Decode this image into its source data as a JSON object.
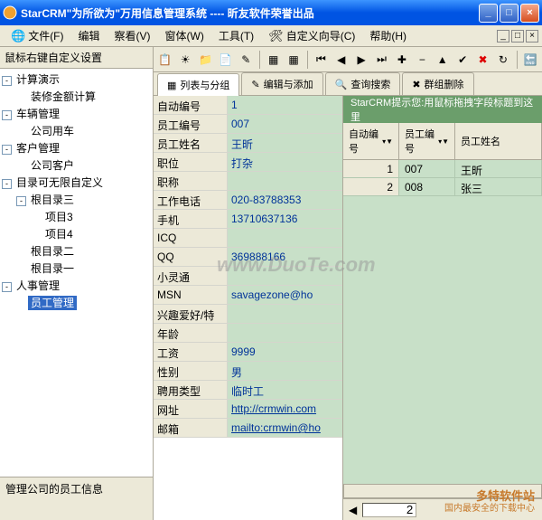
{
  "window": {
    "title": "StarCRM\"为所欲为\"万用信息管理系统 ---- 昕友软件荣誉出品"
  },
  "menu": {
    "file": "文件(F)",
    "edit": "编辑",
    "view": "察看(V)",
    "window": "窗体(W)",
    "tools": "工具(T)",
    "wizard": "自定义向导(C)",
    "help": "帮助(H)"
  },
  "sidebar": {
    "title": "鼠标右键自定义设置",
    "footer": "管理公司的员工信息",
    "nodes": [
      {
        "label": "计算演示",
        "depth": 0,
        "exp": "-"
      },
      {
        "label": "装修金额计算",
        "depth": 1,
        "leaf": true
      },
      {
        "label": "车辆管理",
        "depth": 0,
        "exp": "-"
      },
      {
        "label": "公司用车",
        "depth": 1,
        "leaf": true
      },
      {
        "label": "客户管理",
        "depth": 0,
        "exp": "-"
      },
      {
        "label": "公司客户",
        "depth": 1,
        "leaf": true
      },
      {
        "label": "目录可无限自定义",
        "depth": 0,
        "exp": "-"
      },
      {
        "label": "根目录三",
        "depth": 1,
        "exp": "-"
      },
      {
        "label": "项目3",
        "depth": 2,
        "leaf": true
      },
      {
        "label": "项目4",
        "depth": 2,
        "leaf": true
      },
      {
        "label": "根目录二",
        "depth": 1,
        "leaf": true
      },
      {
        "label": "根目录一",
        "depth": 1,
        "leaf": true
      },
      {
        "label": "人事管理",
        "depth": 0,
        "exp": "-"
      },
      {
        "label": "员工管理",
        "depth": 1,
        "leaf": true,
        "sel": true
      }
    ]
  },
  "tabs": {
    "list": "列表与分组",
    "edit": "编辑与添加",
    "search": "查询搜索",
    "group": "群组删除"
  },
  "form": [
    {
      "k": "自动编号",
      "v": "1"
    },
    {
      "k": "员工编号",
      "v": "007"
    },
    {
      "k": "员工姓名",
      "v": "王昕"
    },
    {
      "k": "职位",
      "v": "打杂"
    },
    {
      "k": "职称",
      "v": ""
    },
    {
      "k": "工作电话",
      "v": "020-83788353"
    },
    {
      "k": "手机",
      "v": "13710637136"
    },
    {
      "k": "ICQ",
      "v": ""
    },
    {
      "k": "QQ",
      "v": "369888166"
    },
    {
      "k": "小灵通",
      "v": ""
    },
    {
      "k": "MSN",
      "v": "savagezone@ho"
    },
    {
      "k": "兴趣爱好/特长",
      "v": ""
    },
    {
      "k": "年龄",
      "v": ""
    },
    {
      "k": "工资",
      "v": "9999"
    },
    {
      "k": "性别",
      "v": "男"
    },
    {
      "k": "聘用类型",
      "v": "临时工"
    },
    {
      "k": "网址",
      "v": "http://crmwin.com",
      "link": true
    },
    {
      "k": "邮箱",
      "v": "mailto:crmwin@ho",
      "link": true
    }
  ],
  "grid": {
    "hint": "StarCRM提示您:用鼠标拖拽字段标题到这里",
    "columns": [
      "自动编号",
      "员工编号",
      "员工姓名"
    ],
    "rows": [
      {
        "n": "1",
        "id": "007",
        "name": "王昕"
      },
      {
        "n": "2",
        "id": "008",
        "name": "张三"
      }
    ],
    "page": "2"
  },
  "watermark": "www.DuoTe.com",
  "duote": {
    "l1": "多特软件站",
    "l2": "国内最安全的下载中心"
  }
}
